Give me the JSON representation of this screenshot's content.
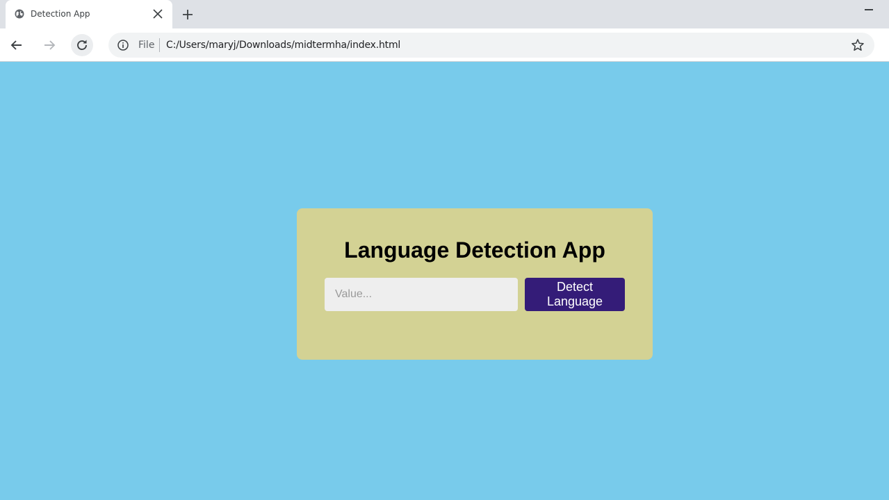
{
  "browser": {
    "tab": {
      "title": "Detection App",
      "favicon": "globe-icon",
      "close_icon": "close-icon"
    },
    "new_tab_icon": "plus-icon",
    "minimize_icon": "minimize-icon",
    "nav": {
      "back_icon": "arrow-left-icon",
      "forward_icon": "arrow-right-icon",
      "reload_icon": "reload-icon"
    },
    "address_bar": {
      "info_icon": "info-icon",
      "scheme_label": "File",
      "url": "C:/Users/maryj/Downloads/midtermha/index.html",
      "bookmark_icon": "star-icon"
    }
  },
  "page": {
    "background_color": "#78cbeb",
    "card_color": "#d3d294",
    "title": "Language Detection App",
    "input": {
      "placeholder": "Value...",
      "value": ""
    },
    "button": {
      "label": "Detect Language",
      "color": "#341c78"
    }
  }
}
